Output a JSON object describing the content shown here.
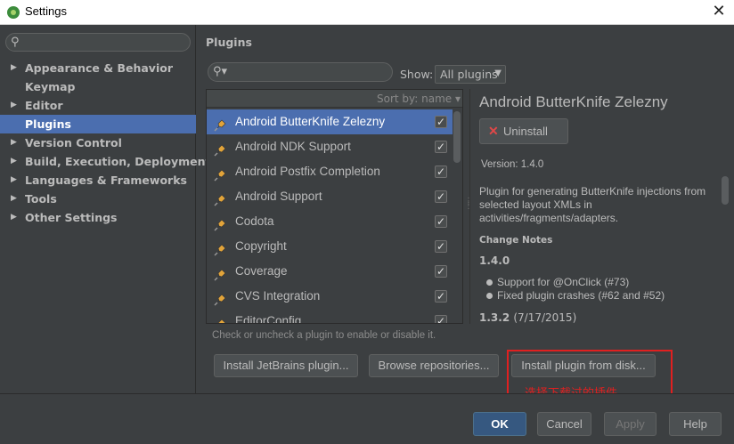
{
  "window": {
    "title": "Settings"
  },
  "sidebar": {
    "items": [
      {
        "label": "Appearance & Behavior",
        "expandable": true
      },
      {
        "label": "Keymap",
        "expandable": false
      },
      {
        "label": "Editor",
        "expandable": true
      },
      {
        "label": "Plugins",
        "expandable": false,
        "selected": true
      },
      {
        "label": "Version Control",
        "expandable": true
      },
      {
        "label": "Build, Execution, Deployment",
        "expandable": true
      },
      {
        "label": "Languages & Frameworks",
        "expandable": true
      },
      {
        "label": "Tools",
        "expandable": true
      },
      {
        "label": "Other Settings",
        "expandable": true
      }
    ]
  },
  "plugins": {
    "title": "Plugins",
    "show_label": "Show:",
    "show_value": "All plugins",
    "sort_label": "Sort by: name",
    "list": [
      {
        "name": "Android ButterKnife Zelezny",
        "checked": true,
        "selected": true
      },
      {
        "name": "Android NDK Support",
        "checked": true
      },
      {
        "name": "Android Postfix Completion",
        "checked": true
      },
      {
        "name": "Android Support",
        "checked": true
      },
      {
        "name": "Codota",
        "checked": true
      },
      {
        "name": "Copyright",
        "checked": true
      },
      {
        "name": "Coverage",
        "checked": true
      },
      {
        "name": "CVS Integration",
        "checked": true
      },
      {
        "name": "EditorConfig",
        "checked": true
      }
    ],
    "hint": "Check or uncheck a plugin to enable or disable it.",
    "buttons": {
      "install_jetbrains": "Install JetBrains plugin...",
      "browse": "Browse repositories...",
      "install_disk": "Install plugin from disk..."
    },
    "annotation": "选择下载过的插件"
  },
  "details": {
    "title": "Android ButterKnife Zelezny",
    "uninstall_label": "Uninstall",
    "version": "Version: 1.4.0",
    "description": "Plugin for generating ButterKnife injections from selected layout XMLs in activities/fragments/adapters.",
    "change_notes_heading": "Change Notes",
    "releases": [
      {
        "version": "1.4.0",
        "date": "",
        "notes": [
          "Support for @OnClick (#73)",
          "Fixed plugin crashes (#62 and #52)"
        ]
      },
      {
        "version": "1.3.2",
        "date": "(7/17/2015)",
        "notes": []
      }
    ]
  },
  "footer": {
    "ok": "OK",
    "cancel": "Cancel",
    "apply": "Apply",
    "help": "Help"
  },
  "colors": {
    "selection": "#4b6eaf",
    "background": "#3c3f41",
    "annotation": "#e02020"
  }
}
